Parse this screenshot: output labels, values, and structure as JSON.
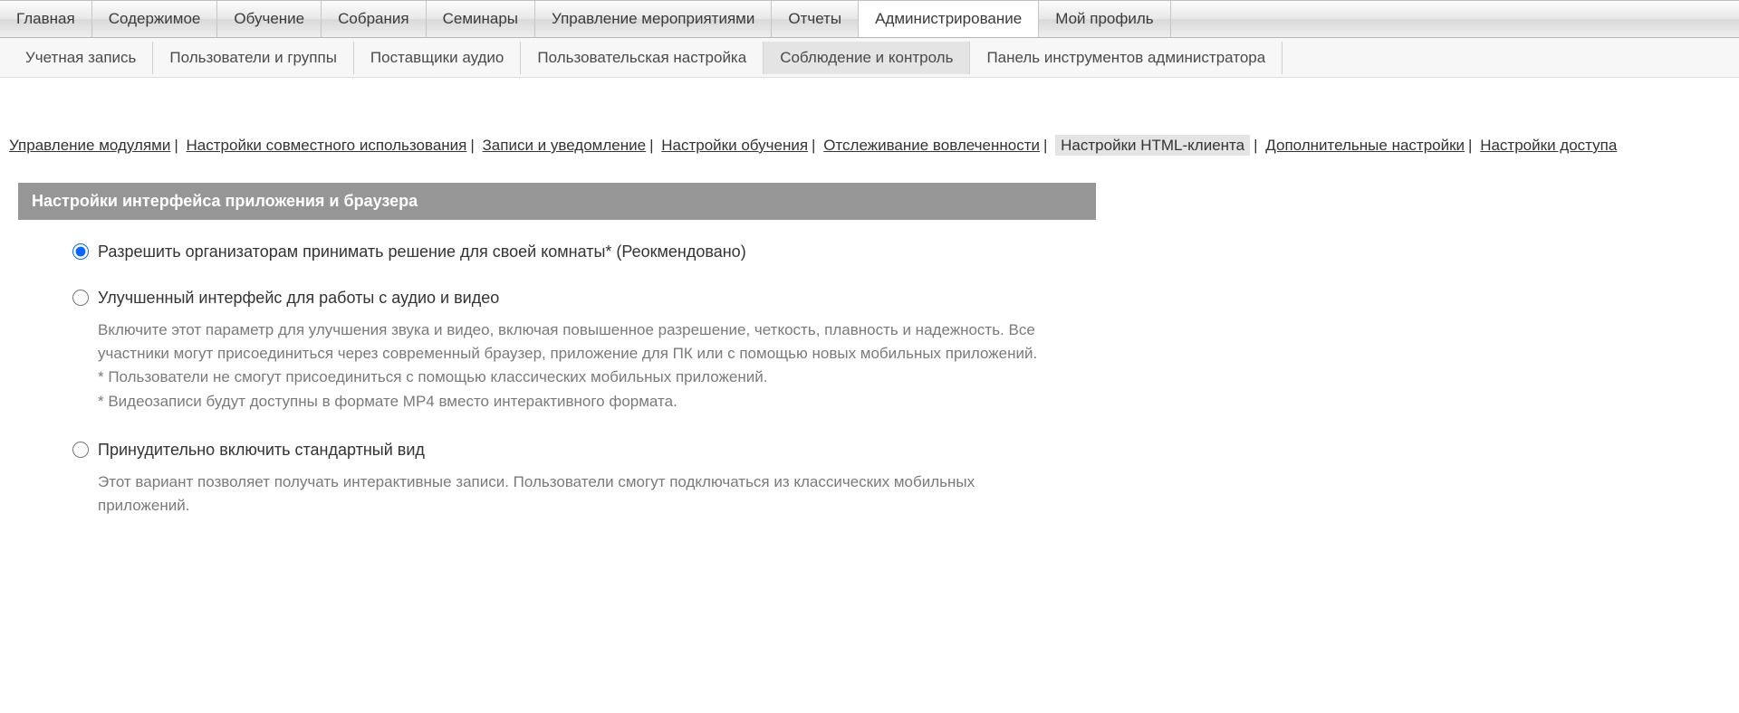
{
  "topNav": {
    "items": [
      {
        "label": "Главная"
      },
      {
        "label": "Содержимое"
      },
      {
        "label": "Обучение"
      },
      {
        "label": "Собрания"
      },
      {
        "label": "Семинары"
      },
      {
        "label": "Управление мероприятиями"
      },
      {
        "label": "Отчеты"
      },
      {
        "label": "Администрирование"
      },
      {
        "label": "Мой профиль"
      }
    ]
  },
  "subNav": {
    "items": [
      {
        "label": "Учетная запись"
      },
      {
        "label": "Пользователи и группы"
      },
      {
        "label": "Поставщики аудио"
      },
      {
        "label": "Пользовательская настройка"
      },
      {
        "label": "Соблюдение и контроль"
      },
      {
        "label": "Панель инструментов администратора"
      }
    ]
  },
  "linkRow": {
    "items": [
      {
        "label": "Управление модулями"
      },
      {
        "label": "Настройки совместного использования"
      },
      {
        "label": "Записи и уведомление"
      },
      {
        "label": "Настройки обучения"
      },
      {
        "label": "Отслеживание вовлеченности"
      },
      {
        "label": "Настройки HTML-клиента"
      },
      {
        "label": "Дополнительные настройки"
      },
      {
        "label": "Настройки доступа"
      }
    ]
  },
  "section": {
    "title": "Настройки интерфейса приложения и браузера"
  },
  "radios": {
    "opt1": {
      "label": "Разрешить организаторам принимать решение для своей комнаты* (Реокмендовано)"
    },
    "opt2": {
      "label": "Улучшенный интерфейс для работы с аудио и видео",
      "desc": "Включите этот параметр для улучшения звука и видео, включая повышенное разрешение, четкость, плавность и надежность. Все участники могут присоединиться через современный браузер, приложение для ПК или с помощью новых мобильных приложений.\n* Пользователи не смогут присоединиться с помощью классических мобильных приложений.\n* Видеозаписи будут доступны в формате MP4 вместо интерактивного формата."
    },
    "opt3": {
      "label": "Принудительно включить стандартный вид",
      "desc": "Этот вариант позволяет получать интерактивные записи. Пользователи смогут подключаться из классических мобильных приложений."
    }
  }
}
